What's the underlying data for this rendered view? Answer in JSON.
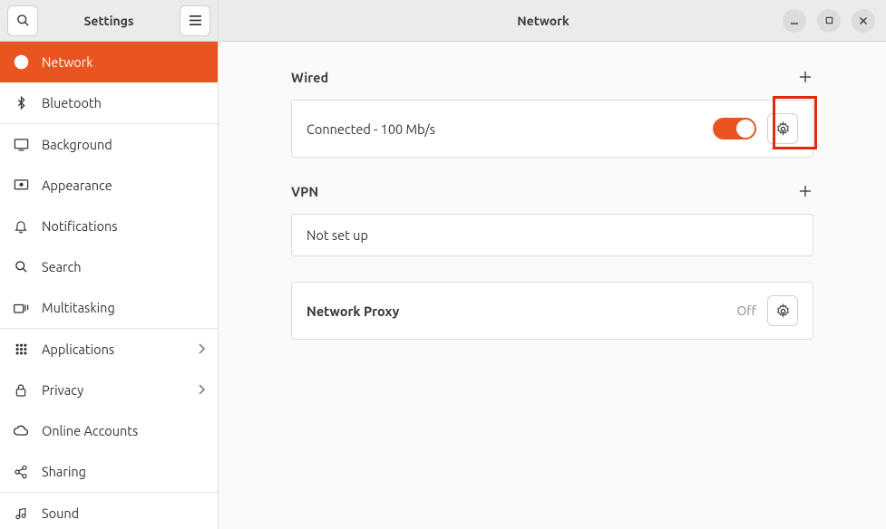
{
  "header": {
    "sidebar_title": "Settings",
    "main_title": "Network"
  },
  "sidebar": {
    "items": [
      {
        "label": "Network",
        "active": true
      },
      {
        "label": "Bluetooth"
      },
      {
        "label": "Background"
      },
      {
        "label": "Appearance"
      },
      {
        "label": "Notifications"
      },
      {
        "label": "Search"
      },
      {
        "label": "Multitasking"
      },
      {
        "label": "Applications",
        "chevron": true
      },
      {
        "label": "Privacy",
        "chevron": true
      },
      {
        "label": "Online Accounts"
      },
      {
        "label": "Sharing"
      },
      {
        "label": "Sound"
      }
    ]
  },
  "sections": {
    "wired": {
      "title": "Wired",
      "status": "Connected - 100 Mb/s",
      "toggle_on": true
    },
    "vpn": {
      "title": "VPN",
      "status": "Not set up"
    },
    "proxy": {
      "title": "Network Proxy",
      "status": "Off"
    }
  },
  "colors": {
    "accent": "#e95420"
  }
}
